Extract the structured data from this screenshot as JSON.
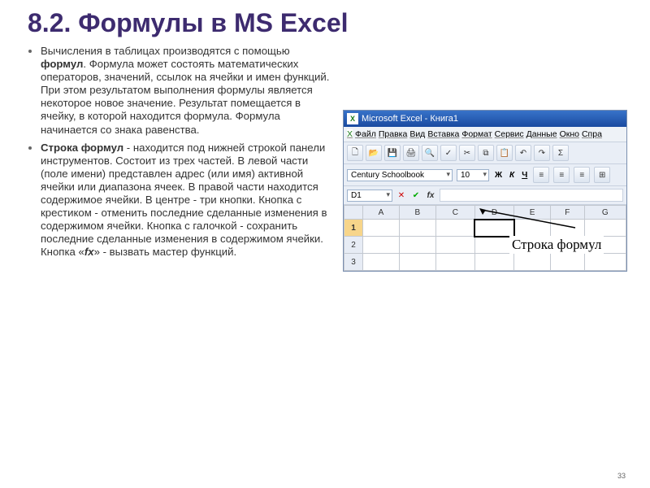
{
  "title": "8.2. Формулы в MS Excel",
  "bullets": [
    {
      "prefix": "Вычисления в таблицах производятся с помощью ",
      "term": "формул",
      "rest": ". Формула может состоять математических операторов, значений, ссылок на ячейки и имен функций. При этом результатом выполнения формулы является некоторое новое значение. Результат помещается в ячейку, в которой находится формула. Формула начинается со знака равенства."
    },
    {
      "term": "Строка формул",
      "rest": " - находится под нижней строкой панели инструментов. Состоит из трех частей. В левой части (поле имени) представлен адрес (или имя) активной ячейки или диапазона ячеек. В правой части находится содержимое ячейки. В центре - три кнопки. Кнопка с крестиком - отменить последние сделанные изменения в содержимом ячейки. Кнопка с галочкой - сохранить последние сделанные изменения в содержимом ячейки. Кнопка «",
      "term2": "fx",
      "rest2": "» - вызвать мастер функций."
    }
  ],
  "excel": {
    "title": "Microsoft Excel - Книга1",
    "menu": [
      "Файл",
      "Правка",
      "Вид",
      "Вставка",
      "Формат",
      "Сервис",
      "Данные",
      "Окно",
      "Спра"
    ],
    "font": "Century Schoolbook",
    "fontsize": "10",
    "format_buttons": [
      "Ж",
      "К",
      "Ч"
    ],
    "namebox": "D1",
    "columns": [
      "A",
      "B",
      "C",
      "D",
      "E",
      "F",
      "G"
    ],
    "rows": [
      "1",
      "2",
      "3"
    ],
    "selected_cell": "D1"
  },
  "callout": "Строка формул",
  "pagenum": "33"
}
